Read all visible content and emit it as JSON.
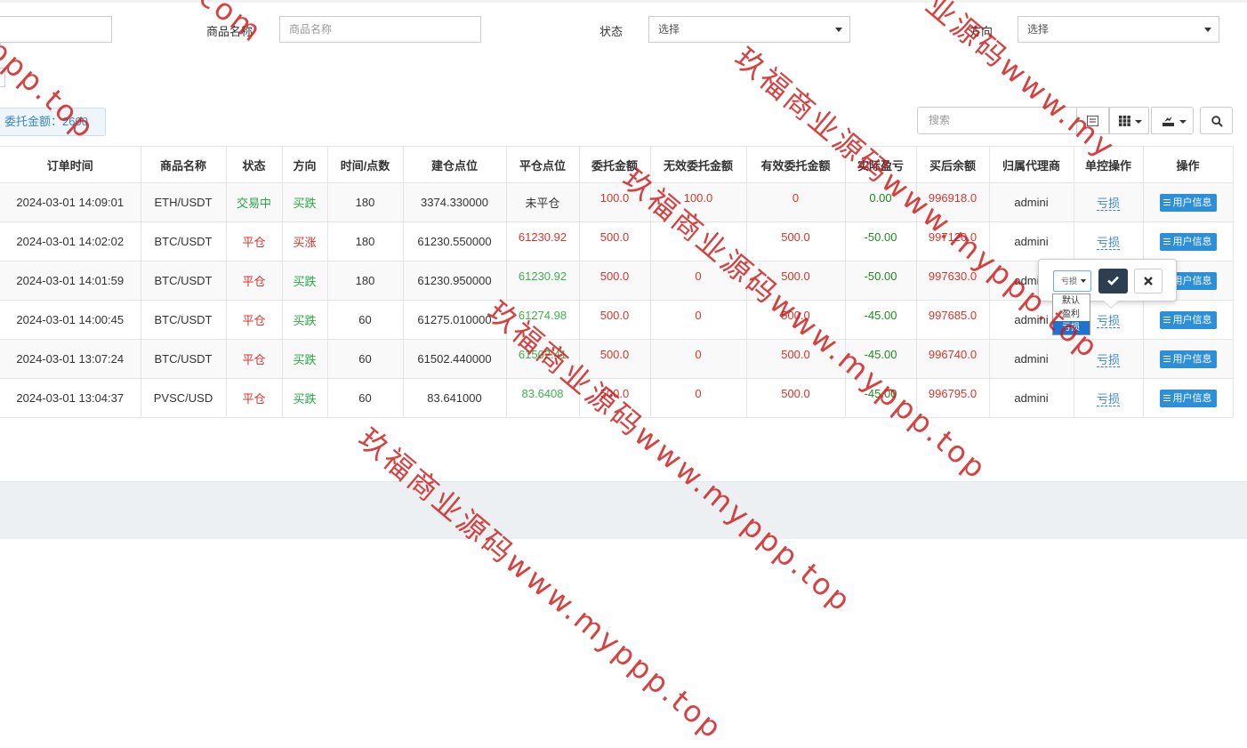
{
  "filters": {
    "first_input_value": "",
    "product_name_label": "商品名称",
    "product_name_placeholder": "商品名称",
    "status_label": "状态",
    "status_value": "选择",
    "direction_label": "方向",
    "direction_value": "选择"
  },
  "summary": {
    "label": "委托金额：",
    "value": "2600"
  },
  "toolbar": {
    "search_placeholder": "搜索"
  },
  "table": {
    "headers": [
      "订单时间",
      "商品名称",
      "状态",
      "方向",
      "时间/点数",
      "建仓点位",
      "平仓点位",
      "委托金额",
      "无效委托金额",
      "有效委托金额",
      "实际盈亏",
      "买后余额",
      "归属代理商",
      "单控操作",
      "操作"
    ],
    "rows": [
      {
        "time": "2024-03-01 14:09:01",
        "product": "ETH/USDT",
        "status": "交易中",
        "direction": "买跌",
        "duration": "180",
        "open_price": "3374.330000",
        "close_price": "未平仓",
        "amount": "100.0",
        "invalid_amount": "100.0",
        "valid_amount": "0",
        "pnl": "0.00",
        "balance": "996918.0",
        "agent": "admini",
        "control": "亏损",
        "action": "用户信息"
      },
      {
        "time": "2024-03-01 14:02:02",
        "product": "BTC/USDT",
        "status": "平仓",
        "direction": "买涨",
        "duration": "180",
        "open_price": "61230.550000",
        "close_price": "61230.92",
        "amount": "500.0",
        "invalid_amount": "",
        "valid_amount": "500.0",
        "pnl": "-50.00",
        "balance": "997120.0",
        "agent": "admini",
        "control": "亏损",
        "action": "用户信息"
      },
      {
        "time": "2024-03-01 14:01:59",
        "product": "BTC/USDT",
        "status": "平仓",
        "direction": "买跌",
        "duration": "180",
        "open_price": "61230.950000",
        "close_price": "61230.92",
        "amount": "500.0",
        "invalid_amount": "0",
        "valid_amount": "500.0",
        "pnl": "-50.00",
        "balance": "997630.0",
        "agent": "admini",
        "control": "亏损",
        "action": "用户信息"
      },
      {
        "time": "2024-03-01 14:00:45",
        "product": "BTC/USDT",
        "status": "平仓",
        "direction": "买跌",
        "duration": "60",
        "open_price": "61275.010000",
        "close_price": "61274.98",
        "amount": "500.0",
        "invalid_amount": "0",
        "valid_amount": "500.0",
        "pnl": "-45.00",
        "balance": "997685.0",
        "agent": "admini",
        "control": "亏损",
        "action": "用户信息"
      },
      {
        "time": "2024-03-01 13:07:24",
        "product": "BTC/USDT",
        "status": "平仓",
        "direction": "买跌",
        "duration": "60",
        "open_price": "61502.440000",
        "close_price": "61502.41",
        "amount": "500.0",
        "invalid_amount": "0",
        "valid_amount": "500.0",
        "pnl": "-45.00",
        "balance": "996740.0",
        "agent": "admini",
        "control": "亏损",
        "action": "用户信息"
      },
      {
        "time": "2024-03-01 13:04:37",
        "product": "PVSC/USD",
        "status": "平仓",
        "direction": "买跌",
        "duration": "60",
        "open_price": "83.641000",
        "close_price": "83.6408",
        "amount": "500.0",
        "invalid_amount": "0",
        "valid_amount": "500.0",
        "pnl": "-45.00",
        "balance": "996795.0",
        "agent": "admini",
        "control": "亏损",
        "action": "用户信息"
      }
    ]
  },
  "popover": {
    "select_value": "亏损",
    "options": [
      "默认",
      "盈利",
      "亏损"
    ],
    "selected_option": "亏损"
  },
  "watermark": {
    "text_a": "玖福商业源码www.myppp.top",
    "text_b": "ppp.top",
    "text_c": ".com",
    "text_d": "业源码www.my"
  },
  "colors": {
    "accent_blue": "#2d8fd5",
    "loss_red": "#d9342b",
    "gain_green": "#28a745",
    "confirm_dark": "#2c3e50",
    "watermark_red": "#cd1919"
  }
}
